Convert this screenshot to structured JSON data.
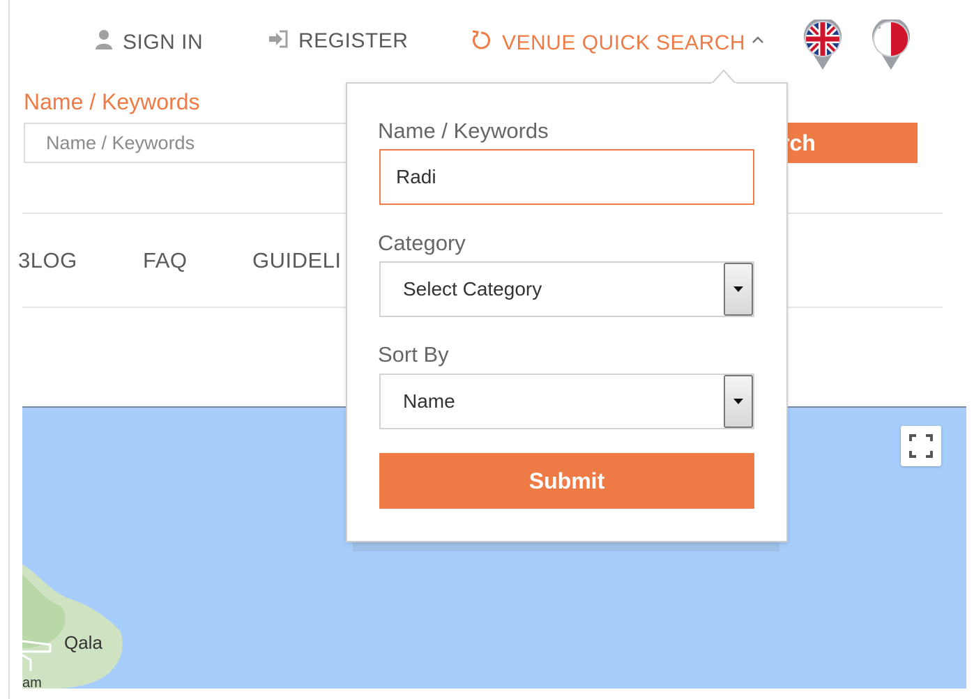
{
  "topnav": {
    "sign_in": "SIGN IN",
    "register": "REGISTER",
    "venue_quick_search": "VENUE QUICK SEARCH",
    "icons": {
      "sign_in": "user-icon",
      "register": "sign-in-icon",
      "quick_search": "refresh-icon",
      "caret": "chevron-up-icon"
    },
    "flags": [
      "uk-flag-pin",
      "malta-flag-pin"
    ]
  },
  "background_form": {
    "label": "Name / Keywords",
    "input_placeholder": "Name / Keywords",
    "search_button_partial": "rch"
  },
  "menu": {
    "items": [
      "3LOG",
      "FAQ",
      "GUIDELI"
    ]
  },
  "map": {
    "town_label": "Qala",
    "corner_text": "am",
    "fullscreen_icon": "fullscreen-icon"
  },
  "quick_search_panel": {
    "name_label": "Name / Keywords",
    "name_value": "Radi",
    "category_label": "Category",
    "category_selected": "Select Category",
    "sort_label": "Sort By",
    "sort_selected": "Name",
    "submit_label": "Submit"
  },
  "colors": {
    "accent": "#ee7b46",
    "map_water": "#a6cdfb",
    "text": "#5a5a5a"
  }
}
